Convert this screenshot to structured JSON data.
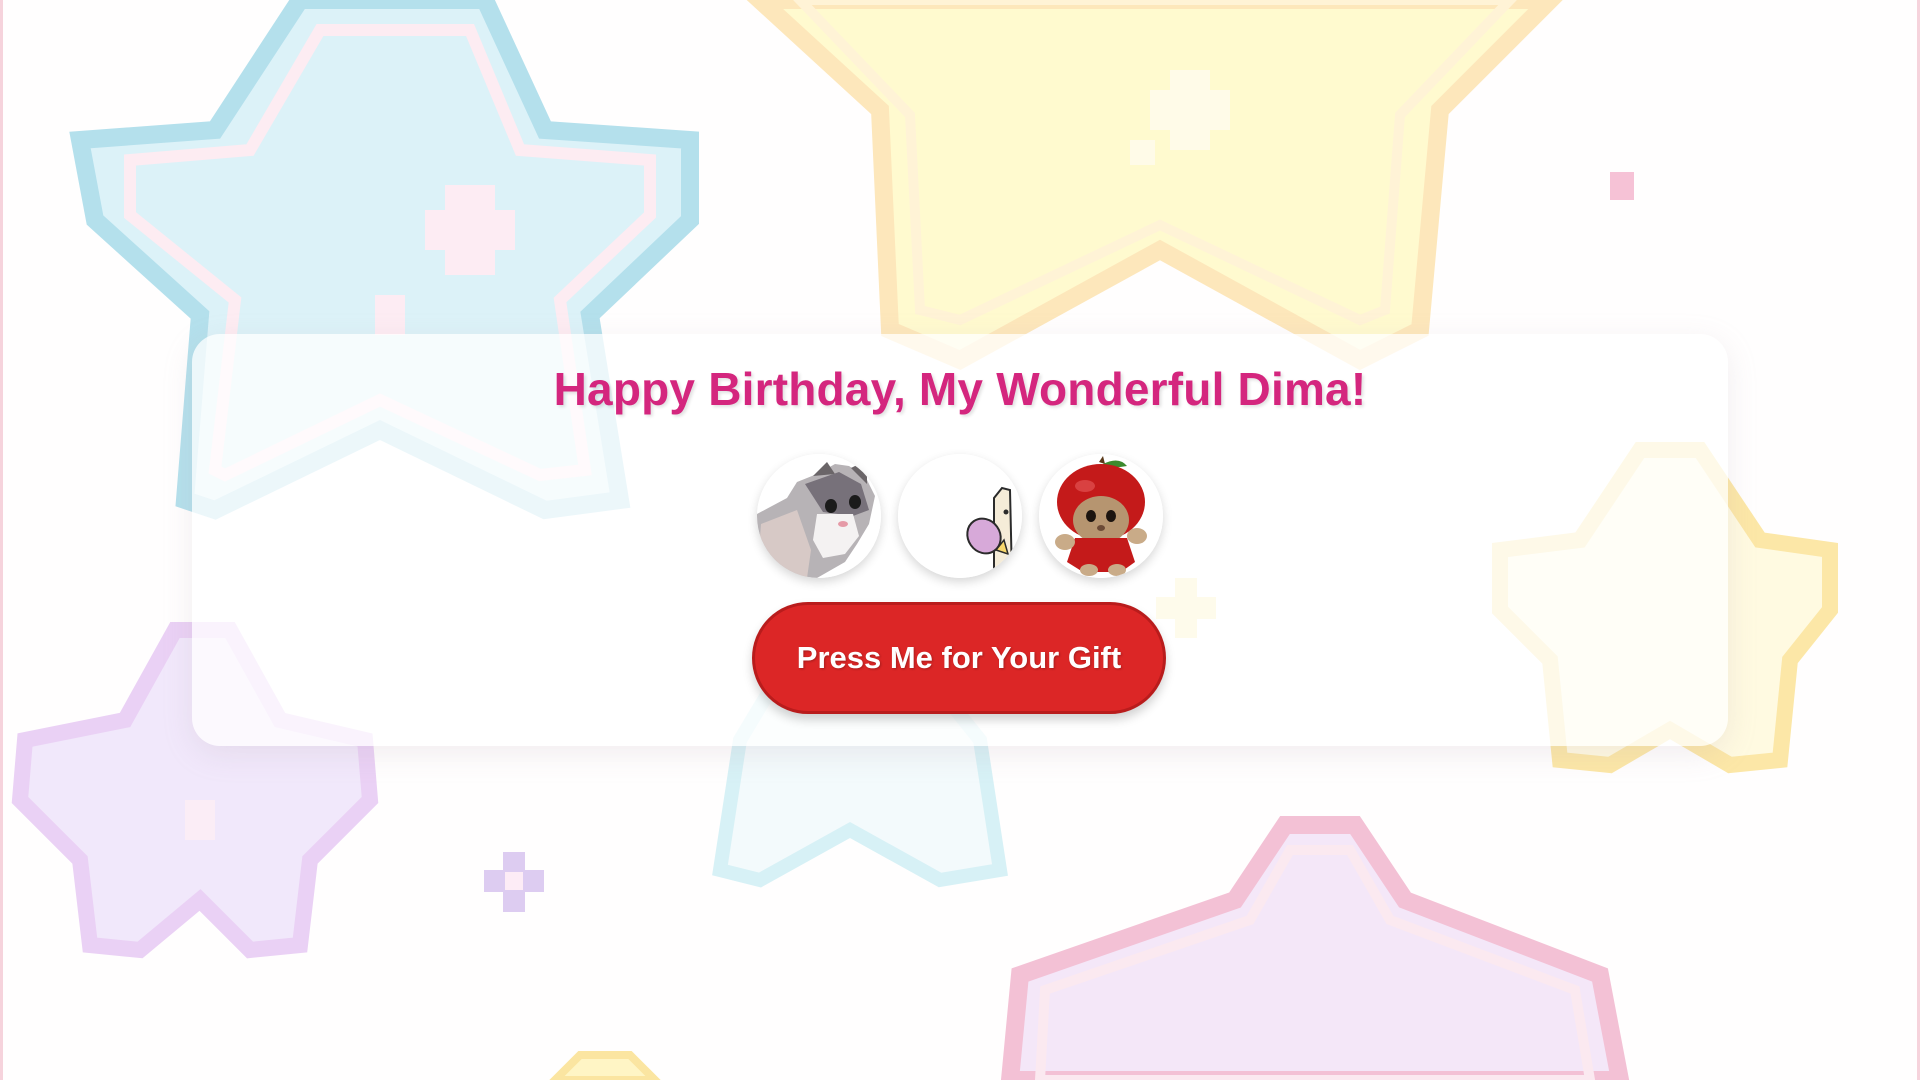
{
  "page": {
    "title": "Happy Birthday, My Wonderful Dima!",
    "gift_button_label": "Press Me for Your Gift"
  },
  "gifs": [
    {
      "icon": "gray-white-cat-icon"
    },
    {
      "icon": "sliding-cartoon-cat-icon"
    },
    {
      "icon": "apple-hat-cat-icon"
    }
  ],
  "colors": {
    "title": "#d4267e",
    "button": "#dc2626",
    "star_blue": "#bfe6f2",
    "star_yellow": "#fff6b8",
    "star_purple": "#ead6f7",
    "star_pink": "#f7b5d0"
  }
}
